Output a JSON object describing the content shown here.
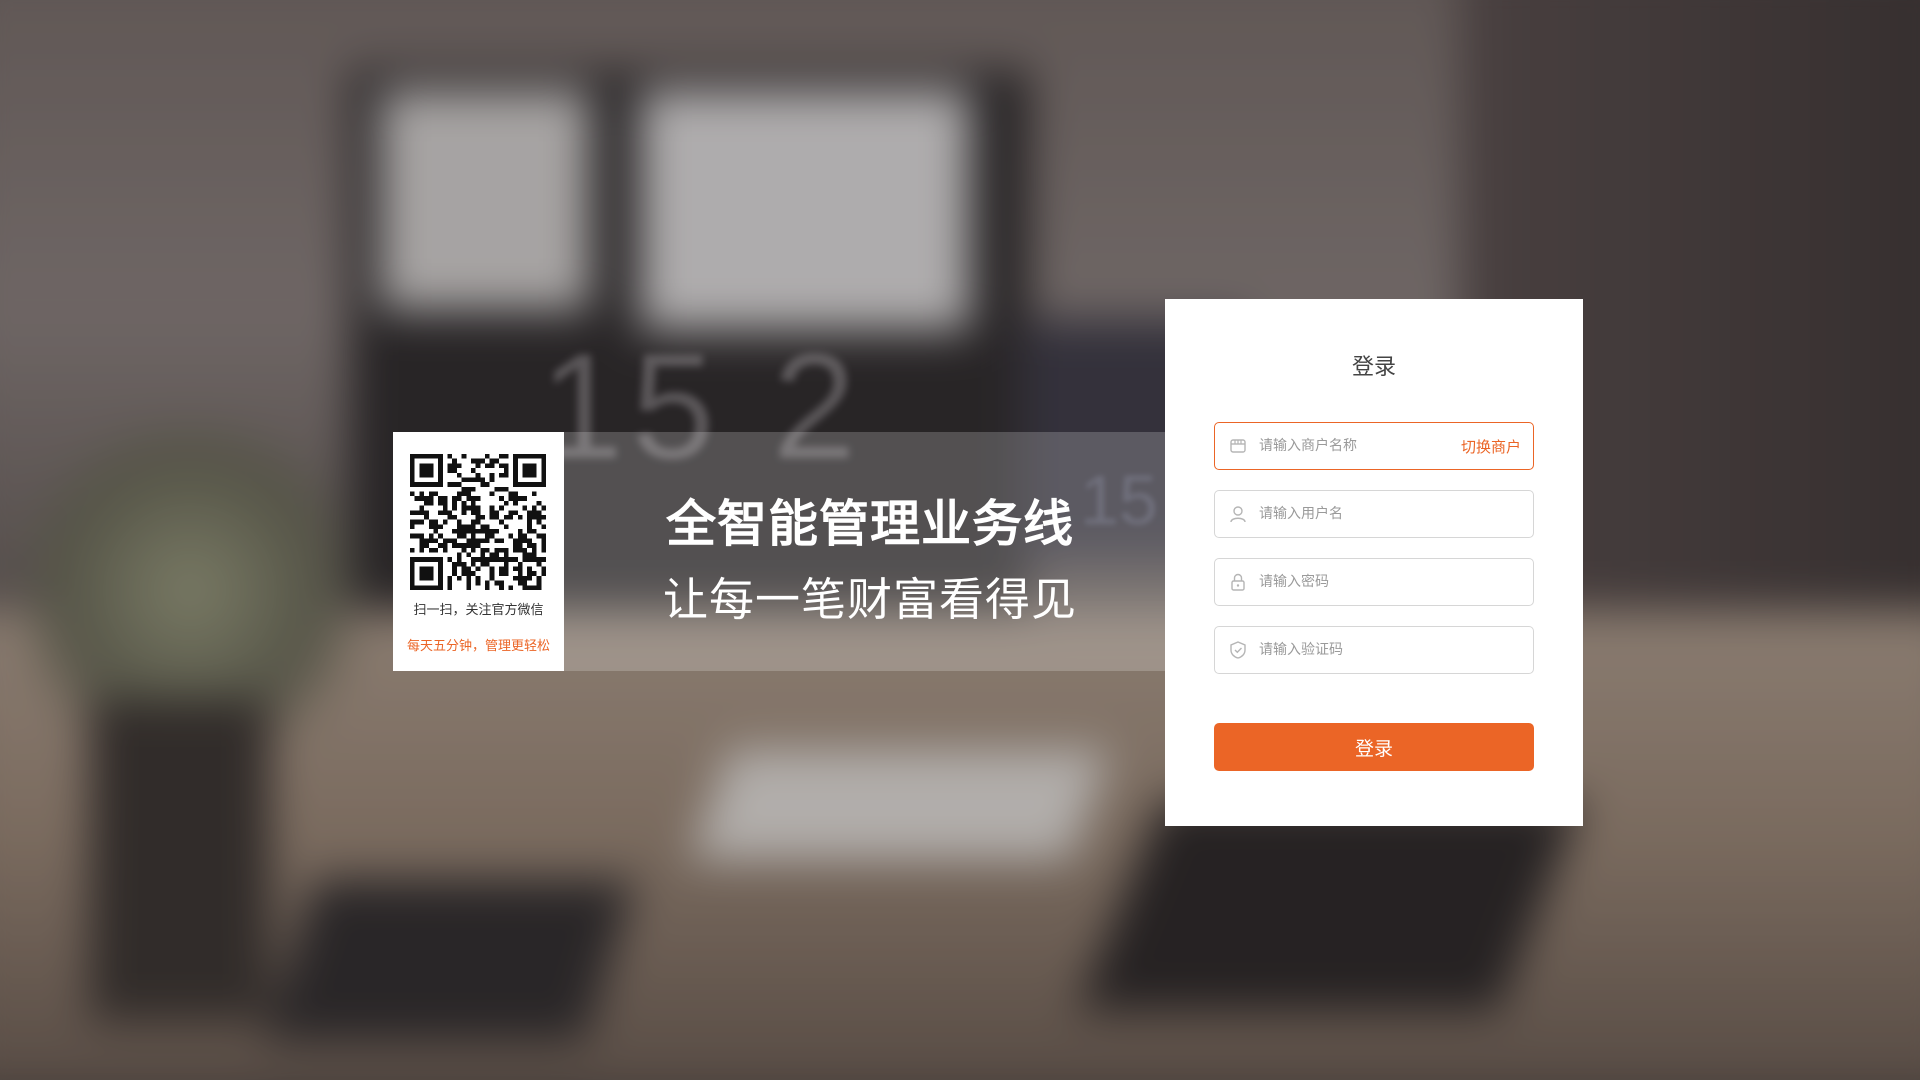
{
  "background": {
    "clock_digits": "15 2",
    "clock_digits_small": "15 2"
  },
  "promo": {
    "title": "全智能管理业务线",
    "subtitle": "让每一笔财富看得见",
    "qr_caption": "扫一扫，关注官方微信",
    "qr_tagline": "每天五分钟，管理更轻松"
  },
  "login": {
    "title": "登录",
    "merchant_placeholder": "请输入商户名称",
    "switch_merchant_label": "切换商户",
    "username_placeholder": "请输入用户名",
    "password_placeholder": "请输入密码",
    "captcha_placeholder": "请输入验证码",
    "submit_label": "登录"
  },
  "icons": {
    "merchant": "store-icon",
    "username": "user-icon",
    "password": "lock-icon",
    "captcha": "shield-icon"
  },
  "colors": {
    "accent": "#eb6526",
    "card_bg": "#ffffff",
    "field_border": "#d6d6d6"
  }
}
